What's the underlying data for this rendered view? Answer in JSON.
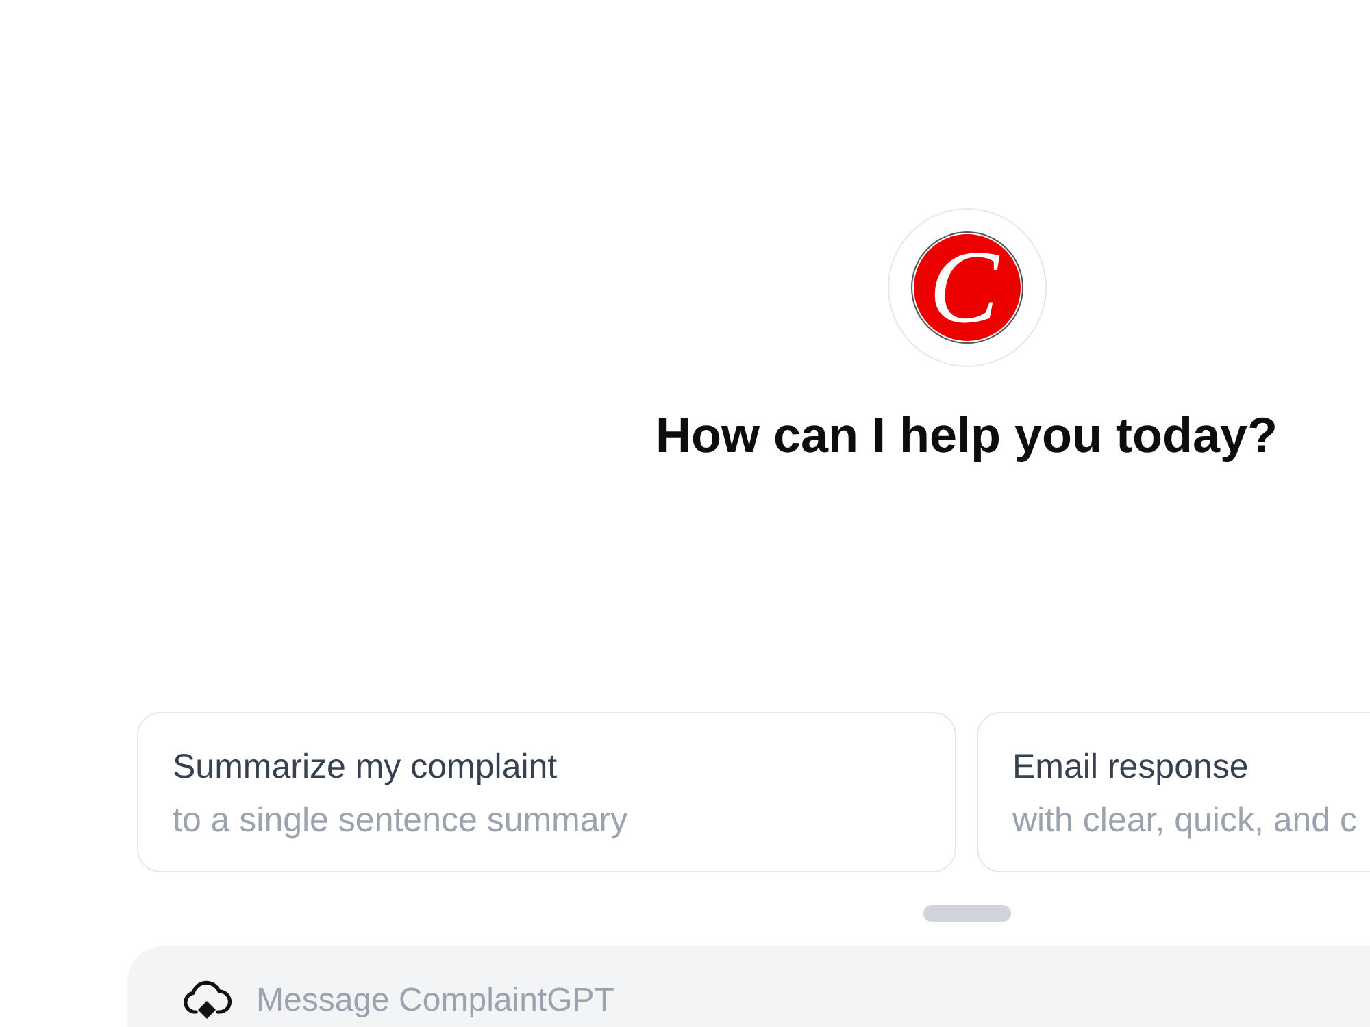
{
  "logo": {
    "letter": "C"
  },
  "heading": "How can I help you today?",
  "suggestions": [
    {
      "title": "Summarize my complaint",
      "subtitle": "to a single sentence summary"
    },
    {
      "title": "Email response",
      "subtitle": "with clear, quick, and c"
    }
  ],
  "composer": {
    "placeholder": "Message ComplaintGPT"
  }
}
